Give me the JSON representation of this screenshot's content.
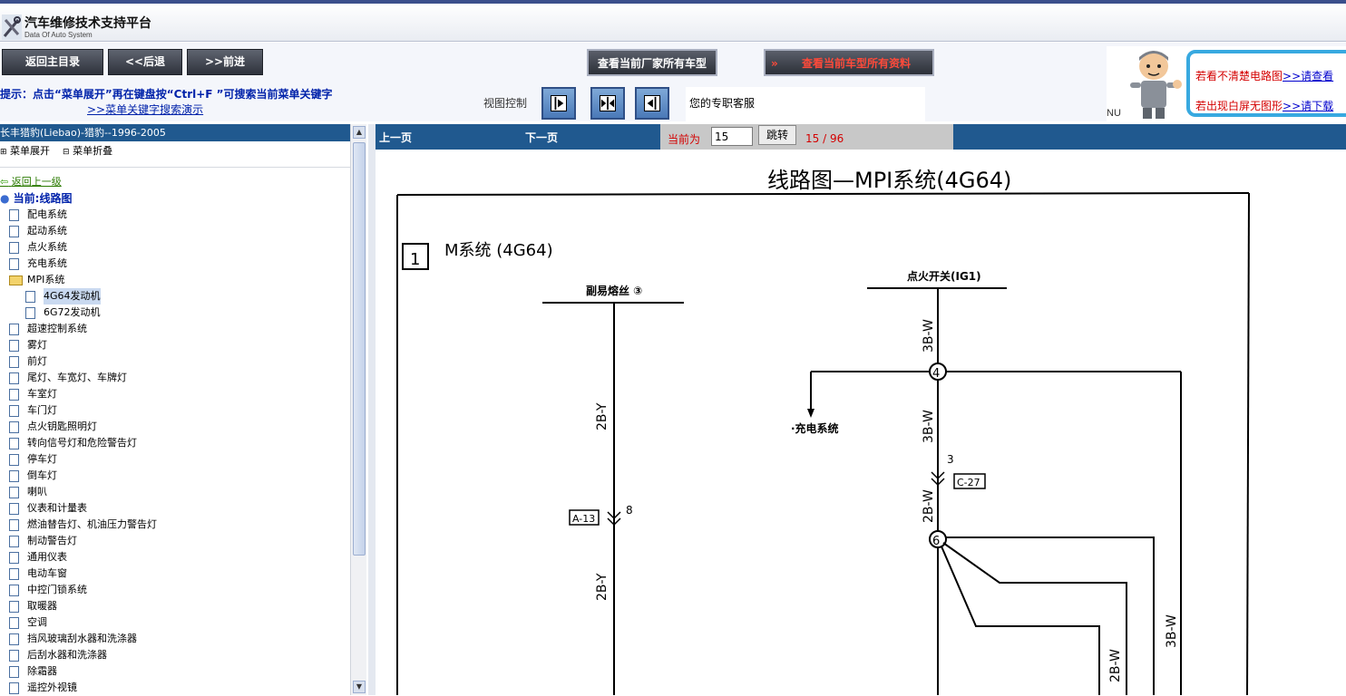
{
  "header": {
    "app_title": "汽车维修技术支持平台",
    "app_subtitle": "Data Of Auto System"
  },
  "toolbar": {
    "home_label": "返回主目录",
    "back_label": "<<后退",
    "forward_label": ">>前进",
    "all_models_label": "查看当前厂家所有车型",
    "all_docs_label": "查看当前车型所有资料"
  },
  "promo": {
    "line1_text": "若看不清楚电路图",
    "line1_link": ">>请查看",
    "line2_text": "若出现白屏无图形",
    "line2_link": ">>请下载",
    "nu": "NU"
  },
  "tipbar": {
    "tip": "提示：点击“菜单展开”再在键盘按“Ctrl+F ”可搜索当前菜单关键字",
    "tip_link": ">>菜单关键字搜索演示",
    "view_label": "视图控制",
    "service_text": "您的专职客服"
  },
  "sidebar": {
    "title": "长丰猎豹(Liebao)-猎豹--1996-2005",
    "expand_label": "菜单展开",
    "collapse_label": "菜单折叠",
    "back_up": "返回上一级",
    "current": "当前:线路图",
    "items": [
      "配电系统",
      "起动系统",
      "点火系统",
      "充电系统"
    ],
    "folder_label": "MPI系统",
    "sub_items": [
      "4G64发动机",
      "6G72发动机"
    ],
    "items_after": [
      "超速控制系统",
      "雾灯",
      "前灯",
      "尾灯、车宽灯、车牌灯",
      "车室灯",
      "车门灯",
      "点火钥匙照明灯",
      "转向信号灯和危险警告灯",
      "停车灯",
      "倒车灯",
      "喇叭",
      "仪表和计量表",
      "燃油替告灯、机油压力警告灯",
      "制动警告灯",
      "通用仪表",
      "电动车窗",
      "中控门锁系统",
      "取暖器",
      "空调",
      "挡风玻璃刮水器和洗涤器",
      "后刮水器和洗涤器",
      "除霜器",
      "遥控外视镜"
    ]
  },
  "viewer": {
    "prev_label": "上一页",
    "next_label": "下一页",
    "current_label": "当前为",
    "page_value": "15",
    "jump_label": "跳转",
    "count": "15 / 96"
  },
  "diagram": {
    "title": "线路图—MPI系统(4G64)",
    "section_no": "1",
    "section_label": "M系统 (4G64)",
    "fuse_label": "副易熔丝 ③",
    "switch_label": "点火开关(IG1)",
    "charge_label": "·充电系统",
    "wire_left_upper": "2B-Y",
    "wire_left_lower": "2B-Y",
    "conn_a13": "A-13",
    "pin8": "8",
    "wire_right_1": "3B-W",
    "wire_right_2": "3B-W",
    "wire_right_3": "2B-W",
    "conn_c27": "C-27",
    "pin3": "3",
    "node4": "4",
    "node6": "6",
    "wire_bottom_1": "2B-W",
    "wire_bottom_2": "3B-W"
  }
}
